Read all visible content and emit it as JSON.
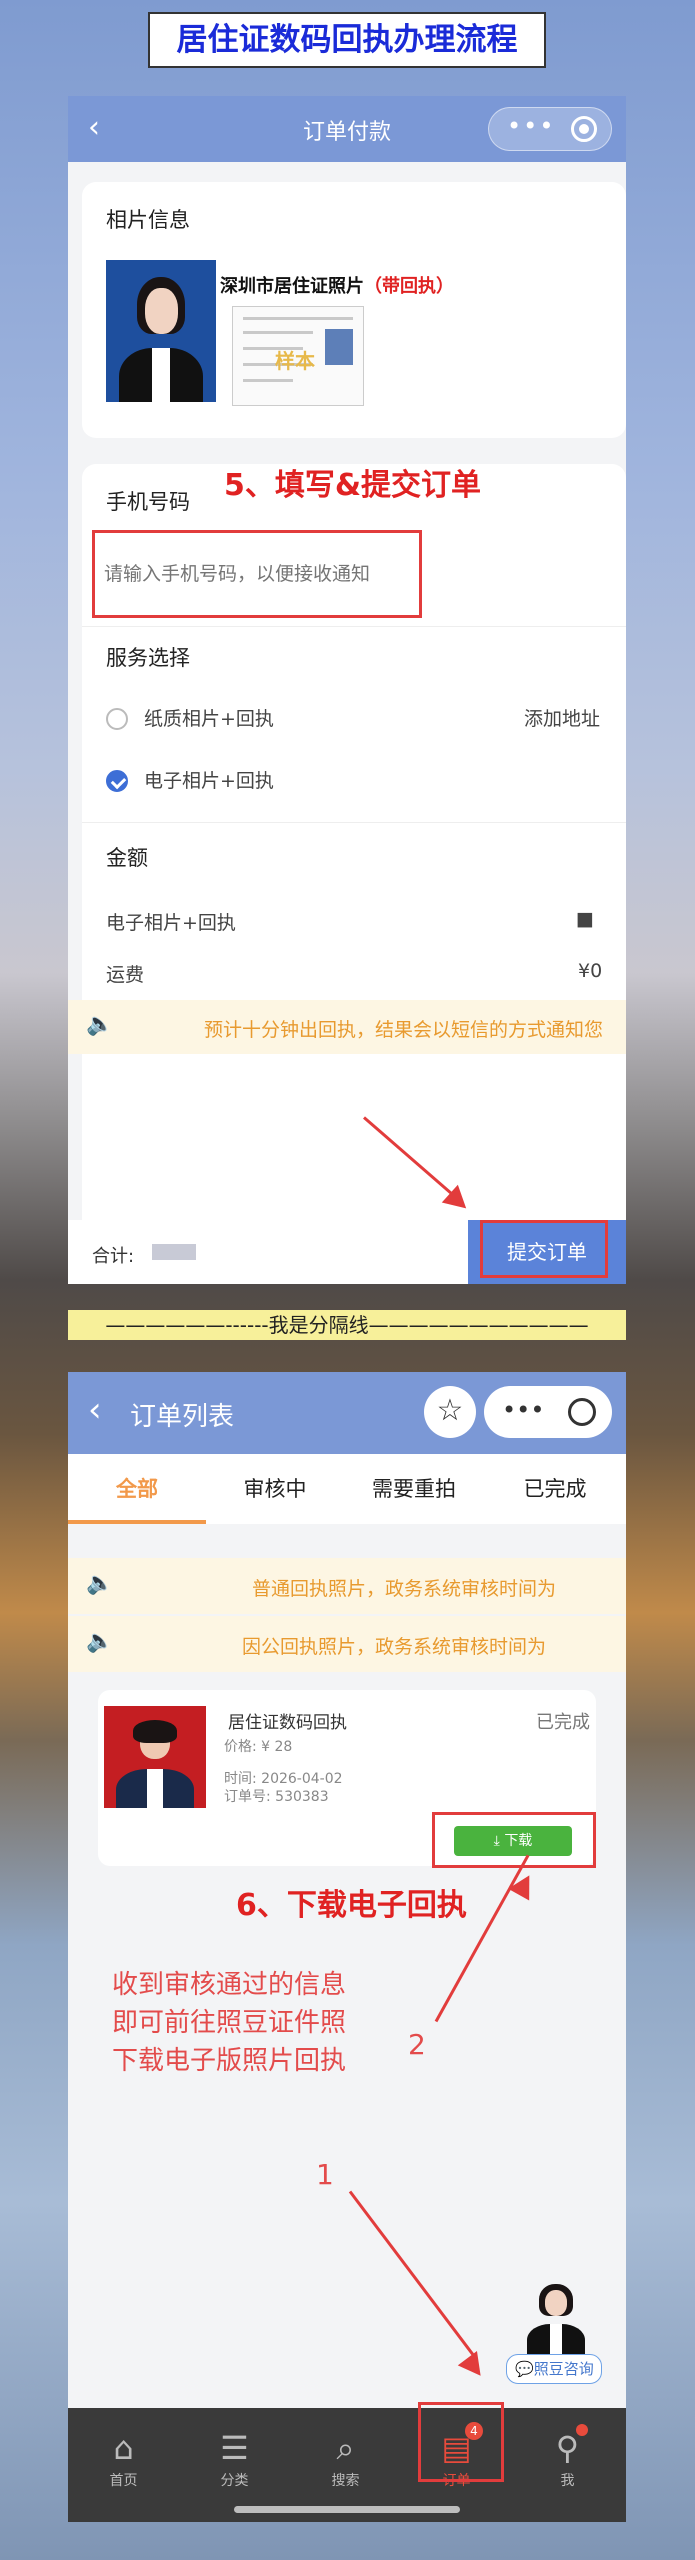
{
  "page_title": "居住证数码回执办理流程",
  "panel1": {
    "nav": {
      "back_icon": "‹",
      "title": "订单付款",
      "dots": "•••"
    },
    "photo_section": {
      "label": "相片信息",
      "product_name": "深圳市居住证照片",
      "product_tag": "（带回执）",
      "receipt_watermark": "样本"
    },
    "step5": "5、填写&提交订单",
    "phone": {
      "label": "手机号码",
      "placeholder": "请输入手机号码，以便接收通知"
    },
    "service": {
      "label": "服务选择",
      "options": [
        {
          "label": "纸质相片+回执",
          "checked": false,
          "extra": "添加地址"
        },
        {
          "label": "电子相片+回执",
          "checked": true,
          "extra": ""
        }
      ]
    },
    "amount": {
      "label": "金额",
      "rows": [
        {
          "label": "电子相片+回执",
          "value": "■"
        },
        {
          "label": "运费",
          "value": "¥0"
        }
      ]
    },
    "notice": "预计十分钟出回执，结果会以短信的方式通知您",
    "bottom": {
      "total_label": "合计:",
      "submit": "提交订单"
    }
  },
  "divider": "——————------我是分隔线———————————",
  "panel2": {
    "nav": {
      "back_icon": "‹",
      "title": "订单列表",
      "star_icon": "☆",
      "dots": "•••"
    },
    "tabs": [
      "全部",
      "审核中",
      "需要重拍",
      "已完成"
    ],
    "notices": [
      "普通回执照片，政务系统审核时间为",
      "因公回执照片，政务系统审核时间为"
    ],
    "order": {
      "title": "居住证数码回执",
      "status": "已完成",
      "price": "价格: ¥ 28",
      "time": "时间: 2026-04-02",
      "order_no": "订单号: 530383",
      "download": "下载"
    },
    "step6": "6、下载电子回执",
    "instruction": [
      "收到审核通过的信息",
      "即可前往照豆证件照",
      "下载电子版照片回执"
    ],
    "marker_1": "1",
    "marker_2": "2",
    "consult": "照豆咨询",
    "tabbar": [
      {
        "label": "首页",
        "icon": "home-icon"
      },
      {
        "label": "分类",
        "icon": "category-search-icon"
      },
      {
        "label": "搜索",
        "icon": "search-icon"
      },
      {
        "label": "订单",
        "icon": "order-icon",
        "badge": "4"
      },
      {
        "label": "我",
        "icon": "user-icon"
      }
    ]
  },
  "colors": {
    "nav_blue": "#7b98d6",
    "accent_orange": "#f2994a",
    "annotation_red": "#e23c3c",
    "download_green": "#4ab33e",
    "title_blue": "#1a2bd8"
  }
}
